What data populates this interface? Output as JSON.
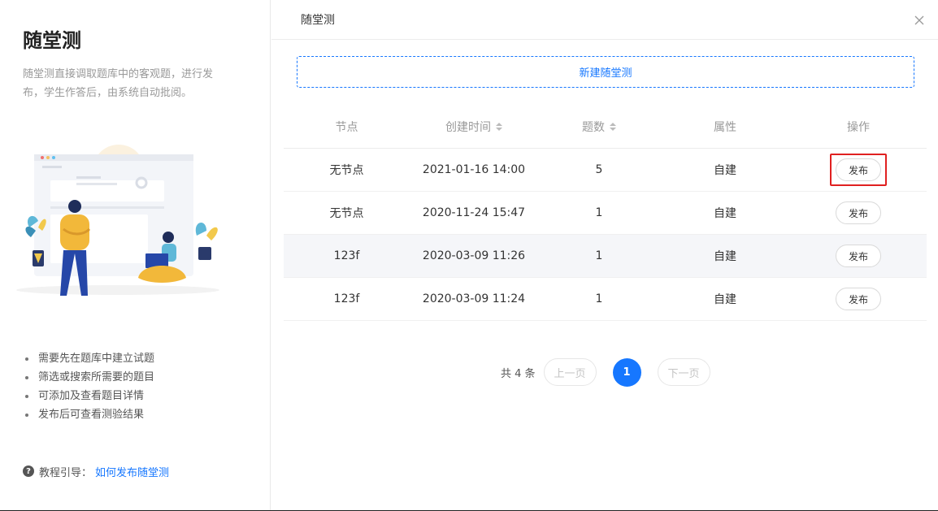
{
  "left": {
    "title": "随堂测",
    "description": "随堂测直接调取题库中的客观题，进行发布，学生作答后，由系统自动批阅。",
    "tips": [
      "需要先在题库中建立试题",
      "筛选或搜索所需要的题目",
      "可添加及查看题目详情",
      "发布后可查看测验结果"
    ],
    "guide_label": "教程引导：",
    "guide_link": "如何发布随堂测"
  },
  "header": {
    "title": "随堂测",
    "close_icon": "close-icon"
  },
  "new_button": "新建随堂测",
  "table": {
    "columns": [
      "节点",
      "创建时间",
      "题数",
      "属性",
      "操作"
    ],
    "rows": [
      {
        "node": "无节点",
        "created": "2021-01-16 14:00",
        "count": "5",
        "attr": "自建",
        "action": "发布"
      },
      {
        "node": "无节点",
        "created": "2020-11-24 15:47",
        "count": "1",
        "attr": "自建",
        "action": "发布"
      },
      {
        "node": "123f",
        "created": "2020-03-09 11:26",
        "count": "1",
        "attr": "自建",
        "action": "发布"
      },
      {
        "node": "123f",
        "created": "2020-03-09 11:24",
        "count": "1",
        "attr": "自建",
        "action": "发布"
      }
    ]
  },
  "pagination": {
    "total": "共 4 条",
    "prev": "上一页",
    "current": "1",
    "next": "下一页"
  },
  "colors": {
    "accent": "#1677ff",
    "highlight": "#e02020"
  }
}
